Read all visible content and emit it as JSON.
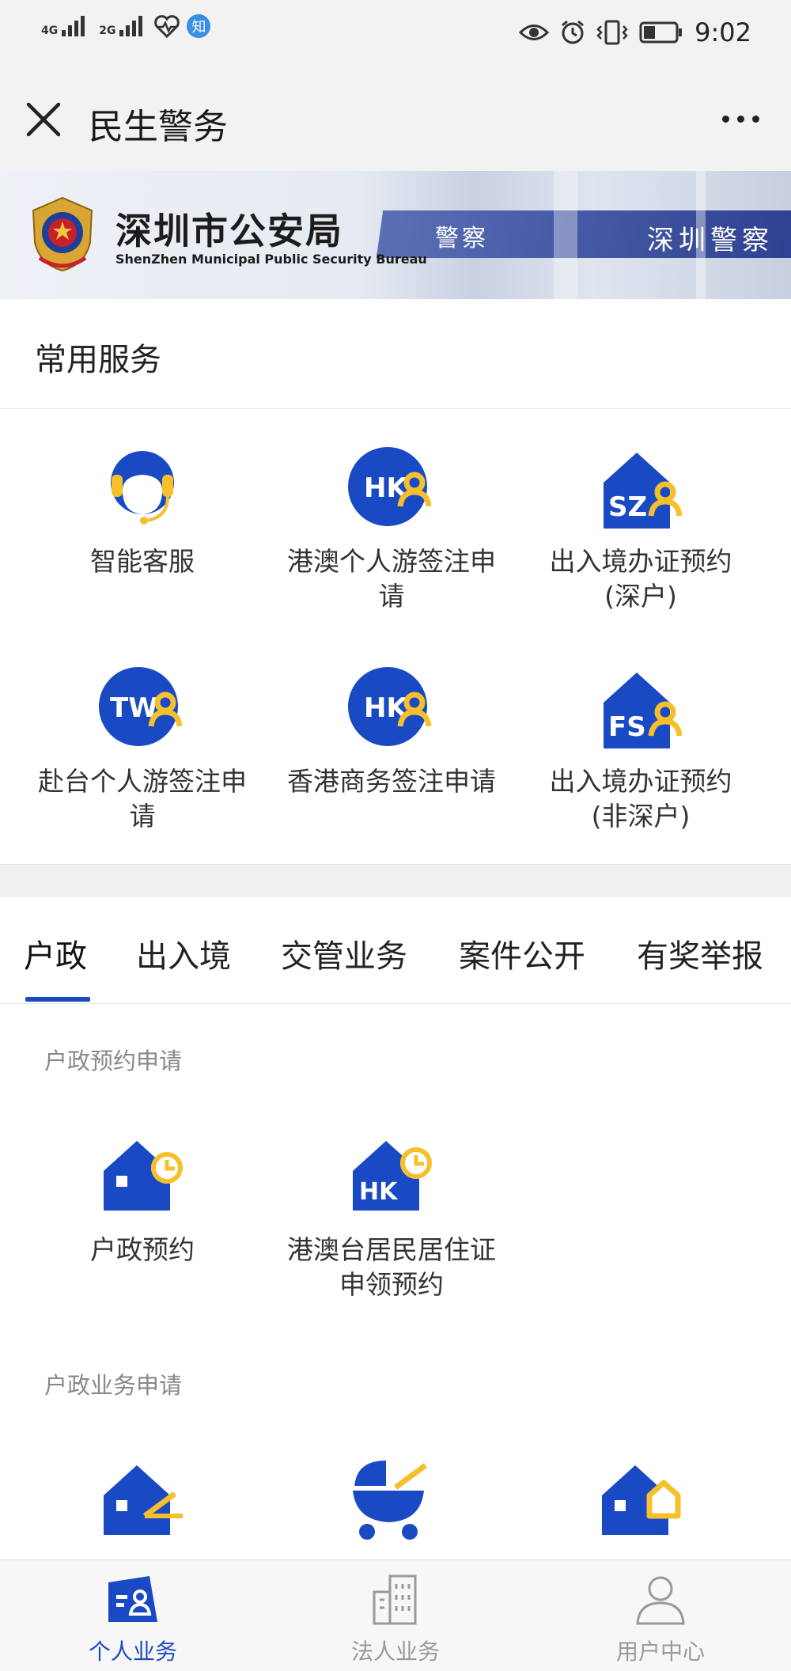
{
  "status_bar": {
    "network1": "4G",
    "network2": "2G",
    "app_badge": "知",
    "time": "9:02"
  },
  "navbar": {
    "title": "民生警务"
  },
  "banner": {
    "title_cn": "深圳市公安局",
    "title_en": "ShenZhen Municipal Public Security Bureau",
    "stripe_text_1": "警察",
    "stripe_text_2": "深圳警察"
  },
  "common_services": {
    "heading": "常用服务",
    "items": [
      {
        "label1": "智能客服",
        "label2": "",
        "icon": "headset-agent-icon"
      },
      {
        "label1": "港澳个人游签注申",
        "label2": "请",
        "icon": "hk-person-icon",
        "badge": "HK"
      },
      {
        "label1": "出入境办证预约",
        "label2": "(深户)",
        "icon": "sz-house-person-icon",
        "badge": "SZ"
      },
      {
        "label1": "赴台个人游签注申",
        "label2": "请",
        "icon": "tw-person-icon",
        "badge": "TW"
      },
      {
        "label1": "香港商务签注申请",
        "label2": "",
        "icon": "hk-person-icon",
        "badge": "HK"
      },
      {
        "label1": "出入境办证预约",
        "label2": "(非深户)",
        "icon": "fs-house-person-icon",
        "badge": "FS"
      }
    ]
  },
  "tabs": {
    "items": [
      "户政",
      "出入境",
      "交管业务",
      "案件公开",
      "有奖举报"
    ],
    "active_index": 0
  },
  "household": {
    "appointment_heading": "户政预约申请",
    "appointment_items": [
      {
        "label1": "户政预约",
        "label2": "",
        "icon": "house-clock-icon"
      },
      {
        "label1": "港澳台居民居住证",
        "label2": "申领预约",
        "icon": "hk-house-clock-icon",
        "badge": "HK"
      }
    ],
    "business_heading": "户政业务申请",
    "business_items": [
      {
        "icon": "house-pen-icon"
      },
      {
        "icon": "baby-stroller-icon"
      },
      {
        "icon": "house-home-icon"
      }
    ]
  },
  "bottom_nav": {
    "items": [
      {
        "label": "个人业务",
        "icon": "personal-card-icon",
        "active": true
      },
      {
        "label": "法人业务",
        "icon": "building-icon",
        "active": false
      },
      {
        "label": "用户中心",
        "icon": "user-icon",
        "active": false
      }
    ]
  },
  "colors": {
    "brand_blue": "#1a49c4",
    "accent_yellow": "#f5c02b",
    "gray_text": "#888888"
  }
}
